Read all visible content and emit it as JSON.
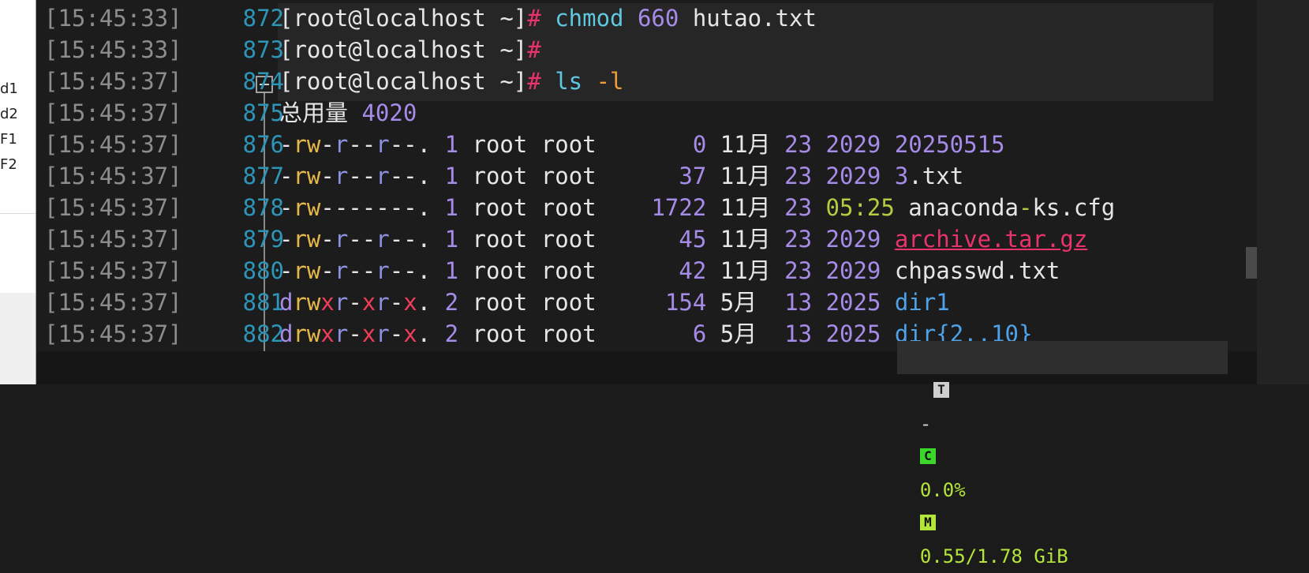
{
  "sidebar": {
    "items": [
      {
        "label": "d1"
      },
      {
        "label": "d2"
      },
      {
        "label": "F1"
      },
      {
        "label": "F2"
      }
    ]
  },
  "terminal": {
    "lines": [
      {
        "time": "[15:45:33]",
        "num": "872",
        "segments": [
          {
            "t": "[root@localhost ~]",
            "c": "w"
          },
          {
            "t": "# ",
            "c": "pk"
          },
          {
            "t": "chmod ",
            "c": "cy"
          },
          {
            "t": "660 ",
            "c": "pu"
          },
          {
            "t": "hutao.txt",
            "c": "w"
          }
        ]
      },
      {
        "time": "[15:45:33]",
        "num": "873",
        "segments": [
          {
            "t": "[root@localhost ~]",
            "c": "w"
          },
          {
            "t": "#",
            "c": "pk"
          }
        ]
      },
      {
        "time": "[15:45:37]",
        "num": "874",
        "segments": [
          {
            "t": "[root@localhost ~]",
            "c": "w"
          },
          {
            "t": "# ",
            "c": "pk"
          },
          {
            "t": "ls ",
            "c": "cy"
          },
          {
            "t": "-l",
            "c": "or"
          }
        ]
      },
      {
        "time": "[15:45:37]",
        "num": "875",
        "segments": [
          {
            "t": "总用量 ",
            "c": "w"
          },
          {
            "t": "4020",
            "c": "pu"
          }
        ]
      },
      {
        "time": "[15:45:37]",
        "num": "876",
        "segments": [
          {
            "t": "-",
            "c": "w"
          },
          {
            "t": "rw",
            "c": "ye"
          },
          {
            "t": "-",
            "c": "w"
          },
          {
            "t": "r",
            "c": "sl"
          },
          {
            "t": "--",
            "c": "w"
          },
          {
            "t": "r",
            "c": "sl"
          },
          {
            "t": "--",
            "c": "w"
          },
          {
            "t": ". ",
            "c": "w"
          },
          {
            "t": "1 ",
            "c": "pu"
          },
          {
            "t": "root root       ",
            "c": "w"
          },
          {
            "t": "0 ",
            "c": "pu"
          },
          {
            "t": "11月 ",
            "c": "w"
          },
          {
            "t": "23 2029 20250515",
            "c": "pu"
          }
        ]
      },
      {
        "time": "[15:45:37]",
        "num": "877",
        "segments": [
          {
            "t": "-",
            "c": "w"
          },
          {
            "t": "rw",
            "c": "ye"
          },
          {
            "t": "-",
            "c": "w"
          },
          {
            "t": "r",
            "c": "sl"
          },
          {
            "t": "--",
            "c": "w"
          },
          {
            "t": "r",
            "c": "sl"
          },
          {
            "t": "--",
            "c": "w"
          },
          {
            "t": ". ",
            "c": "w"
          },
          {
            "t": "1 ",
            "c": "pu"
          },
          {
            "t": "root root      ",
            "c": "w"
          },
          {
            "t": "37 ",
            "c": "pu"
          },
          {
            "t": "11月 ",
            "c": "w"
          },
          {
            "t": "23 2029 3",
            "c": "pu"
          },
          {
            "t": ".txt",
            "c": "w"
          }
        ]
      },
      {
        "time": "[15:45:37]",
        "num": "878",
        "segments": [
          {
            "t": "-",
            "c": "w"
          },
          {
            "t": "rw",
            "c": "ye"
          },
          {
            "t": "-------",
            "c": "w"
          },
          {
            "t": ". ",
            "c": "w"
          },
          {
            "t": "1 ",
            "c": "pu"
          },
          {
            "t": "root root    ",
            "c": "w"
          },
          {
            "t": "1722 ",
            "c": "pu"
          },
          {
            "t": "11月 ",
            "c": "w"
          },
          {
            "t": "23 ",
            "c": "pu"
          },
          {
            "t": "05:25 ",
            "c": "gn"
          },
          {
            "t": "anaconda",
            "c": "w"
          },
          {
            "t": "-",
            "c": "gn"
          },
          {
            "t": "ks.cfg",
            "c": "w"
          }
        ]
      },
      {
        "time": "[15:45:37]",
        "num": "879",
        "segments": [
          {
            "t": "-",
            "c": "w"
          },
          {
            "t": "rw",
            "c": "ye"
          },
          {
            "t": "-",
            "c": "w"
          },
          {
            "t": "r",
            "c": "sl"
          },
          {
            "t": "--",
            "c": "w"
          },
          {
            "t": "r",
            "c": "sl"
          },
          {
            "t": "--",
            "c": "w"
          },
          {
            "t": ". ",
            "c": "w"
          },
          {
            "t": "1 ",
            "c": "pu"
          },
          {
            "t": "root root      ",
            "c": "w"
          },
          {
            "t": "45 ",
            "c": "pu"
          },
          {
            "t": "11月 ",
            "c": "w"
          },
          {
            "t": "23 2029 ",
            "c": "pu"
          },
          {
            "t": "archive.tar.gz",
            "c": "pk ul"
          }
        ]
      },
      {
        "time": "[15:45:37]",
        "num": "880",
        "segments": [
          {
            "t": "-",
            "c": "w"
          },
          {
            "t": "rw",
            "c": "ye"
          },
          {
            "t": "-",
            "c": "w"
          },
          {
            "t": "r",
            "c": "sl"
          },
          {
            "t": "--",
            "c": "w"
          },
          {
            "t": "r",
            "c": "sl"
          },
          {
            "t": "--",
            "c": "w"
          },
          {
            "t": ". ",
            "c": "w"
          },
          {
            "t": "1 ",
            "c": "pu"
          },
          {
            "t": "root root      ",
            "c": "w"
          },
          {
            "t": "42 ",
            "c": "pu"
          },
          {
            "t": "11月 ",
            "c": "w"
          },
          {
            "t": "23 2029 ",
            "c": "pu"
          },
          {
            "t": "chpasswd.txt",
            "c": "w"
          }
        ]
      },
      {
        "time": "[15:45:37]",
        "num": "881",
        "segments": [
          {
            "t": "d",
            "c": "pu"
          },
          {
            "t": "rw",
            "c": "ye"
          },
          {
            "t": "x",
            "c": "rd"
          },
          {
            "t": "r",
            "c": "sl"
          },
          {
            "t": "-",
            "c": "w"
          },
          {
            "t": "x",
            "c": "rd"
          },
          {
            "t": "r",
            "c": "sl"
          },
          {
            "t": "-",
            "c": "w"
          },
          {
            "t": "x",
            "c": "rd"
          },
          {
            "t": ". ",
            "c": "w"
          },
          {
            "t": "2 ",
            "c": "pu"
          },
          {
            "t": "root root     ",
            "c": "w"
          },
          {
            "t": "154 ",
            "c": "pu"
          },
          {
            "t": "5月  ",
            "c": "w"
          },
          {
            "t": "13 2025 ",
            "c": "pu"
          },
          {
            "t": "dir1",
            "c": "bl"
          }
        ]
      },
      {
        "time": "[15:45:37]",
        "num": "882",
        "segments": [
          {
            "t": "d",
            "c": "pu"
          },
          {
            "t": "rw",
            "c": "ye"
          },
          {
            "t": "x",
            "c": "rd"
          },
          {
            "t": "r",
            "c": "sl"
          },
          {
            "t": "-",
            "c": "w"
          },
          {
            "t": "x",
            "c": "rd"
          },
          {
            "t": "r",
            "c": "sl"
          },
          {
            "t": "-",
            "c": "w"
          },
          {
            "t": "x",
            "c": "rd"
          },
          {
            "t": ". ",
            "c": "w"
          },
          {
            "t": "2 ",
            "c": "pu"
          },
          {
            "t": "root root       ",
            "c": "w"
          },
          {
            "t": "6 ",
            "c": "pu"
          },
          {
            "t": "5月  ",
            "c": "w"
          },
          {
            "t": "13 2025 ",
            "c": "pu"
          },
          {
            "t": "dir{2..10}",
            "c": "bl"
          }
        ]
      }
    ]
  },
  "status": {
    "term_badge": "T",
    "dash": "-",
    "cpu_badge": "C",
    "cpu_value": "0.0%",
    "mem_badge": "M",
    "mem_value": "0.55/1.78 GiB"
  },
  "colors": {
    "background": "#1c1c1c",
    "prompt_hash": "#e8336b",
    "command": "#5fc8e0",
    "number": "#a68be8",
    "line_number": "#2d96b8",
    "directory": "#4ea2ea"
  }
}
